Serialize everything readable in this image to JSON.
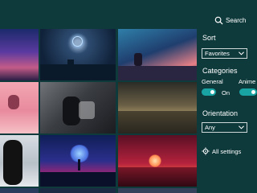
{
  "search": {
    "label": "Search"
  },
  "sort": {
    "title": "Sort",
    "selected": "Favorites"
  },
  "categories": {
    "title": "Categories",
    "general": {
      "label": "General",
      "state": "On"
    },
    "anime": {
      "label": "Anime"
    }
  },
  "orientation": {
    "title": "Orientation",
    "selected": "Any"
  },
  "settings": {
    "label": "All settings"
  },
  "colors": {
    "background": "#0f3a3c",
    "accent": "#1aa3a3"
  }
}
